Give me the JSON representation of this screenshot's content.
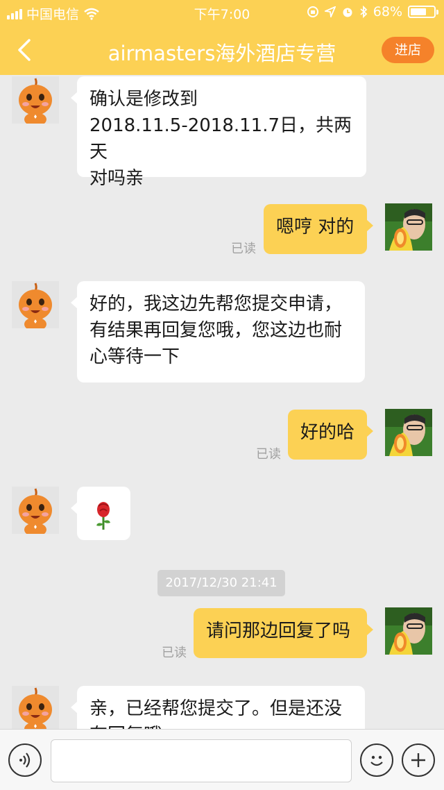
{
  "status_bar": {
    "carrier": "中国电信",
    "time": "下午7:00",
    "battery": "68%",
    "battery_level": 0.68
  },
  "nav": {
    "title": "airmasters海外酒店专营",
    "enter_store": "进店"
  },
  "messages": [
    {
      "from": "seller",
      "text": "确认是修改到\n2018.11.5-2018.11.7日，共两天\n对吗亲"
    },
    {
      "from": "me",
      "text": "嗯哼 对的",
      "status": "已读"
    },
    {
      "from": "seller",
      "text": "好的，我这边先帮您提交申请，\n有结果再回复您哦，您这边也耐\n心等待一下"
    },
    {
      "from": "me",
      "text": "好的哈",
      "status": "已读"
    },
    {
      "from": "seller",
      "emoji": "rose-emoji"
    },
    {
      "timestamp": "2017/12/30 21:41"
    },
    {
      "from": "me",
      "text": "请问那边回复了吗",
      "status": "已读"
    },
    {
      "from": "seller",
      "text": "亲，已经帮您提交了。但是还没\n有回复哦"
    }
  ],
  "input": {
    "value": "",
    "placeholder": ""
  },
  "icons": {
    "back": "chevron-left-icon",
    "voice": "voice-icon",
    "emoji": "smiley-icon",
    "more": "plus-icon"
  },
  "colors": {
    "header": "#fcd154",
    "outgoing_bubble": "#fcd154",
    "incoming_bubble": "#ffffff",
    "enter_button": "#f5822a",
    "background": "#ebebeb"
  }
}
